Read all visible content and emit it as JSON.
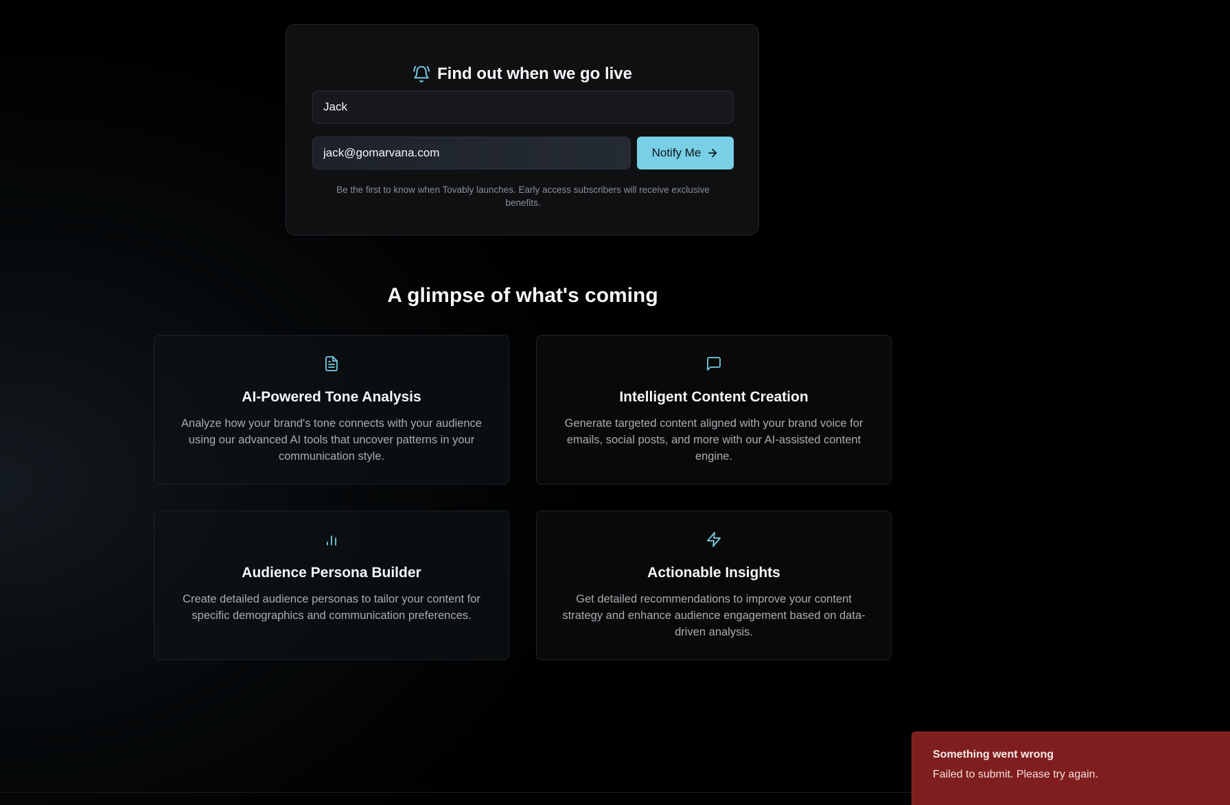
{
  "signup": {
    "title": "Find out when we go live",
    "title_icon": "bell-icon",
    "name_value": "Jack",
    "email_value": "jack@gomarvana.com",
    "notify_label": "Notify Me",
    "notify_icon": "arrow-right-icon",
    "note": "Be the first to know when Tovably launches. Early access subscribers will receive exclusive benefits."
  },
  "features": {
    "section_title": "A glimpse of what's coming",
    "items": [
      {
        "icon": "document-icon",
        "title": "AI-Powered Tone Analysis",
        "description": "Analyze how your brand's tone connects with your audience using our advanced AI tools that uncover patterns in your communication style."
      },
      {
        "icon": "message-square-icon",
        "title": "Intelligent Content Creation",
        "description": "Generate targeted content aligned with your brand voice for emails, social posts, and more with our AI-assisted content engine."
      },
      {
        "icon": "bar-chart-icon",
        "title": "Audience Persona Builder",
        "description": "Create detailed audience personas to tailor your content for specific demographics and communication preferences."
      },
      {
        "icon": "zap-icon",
        "title": "Actionable Insights",
        "description": "Get detailed recommendations to improve your content strategy and enhance audience engagement based on data-driven analysis."
      }
    ]
  },
  "toast": {
    "title": "Something went wrong",
    "message": "Failed to submit. Please try again."
  },
  "colors": {
    "accent": "#78cfe6",
    "background": "#000000",
    "card": "#0f1012",
    "toast_error": "#7f1e1e"
  }
}
